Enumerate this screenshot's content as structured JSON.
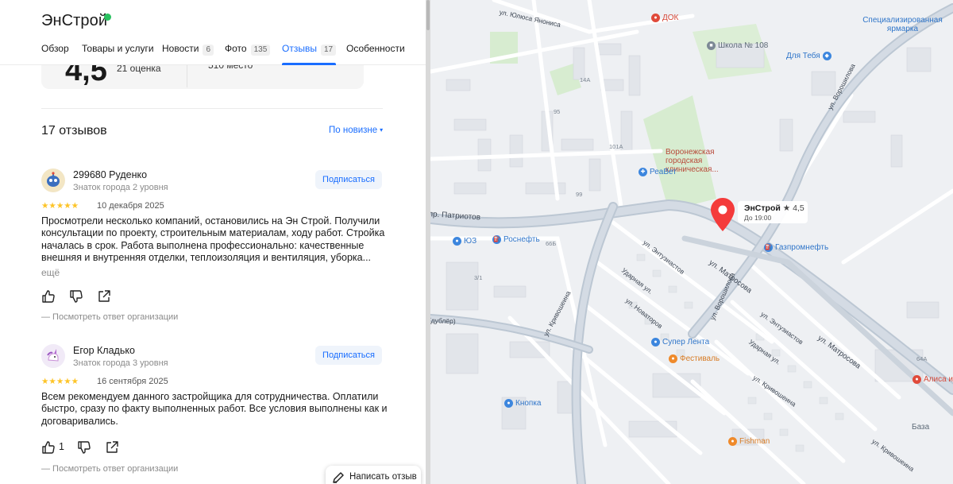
{
  "org": {
    "title": "ЭнСтрой"
  },
  "tabs": [
    {
      "label": "Обзор",
      "count": ""
    },
    {
      "label": "Товары и услуги",
      "count": ""
    },
    {
      "label": "Новости",
      "count": "6"
    },
    {
      "label": "Фото",
      "count": "135"
    },
    {
      "label": "Отзывы",
      "count": "17"
    },
    {
      "label": "Особенности",
      "count": ""
    }
  ],
  "rating": {
    "value": "4,5",
    "count_label": "21 оценка",
    "place_label": "510 место"
  },
  "reviews_section": {
    "heading": "17 отзывов",
    "sort_label": "По новизне",
    "sort_caret": "▾"
  },
  "reviews": [
    {
      "author": "299680 Руденко",
      "level": "Знаток города 2 уровня",
      "subscribe": "Подписаться",
      "stars": "★★★★★",
      "rating": 5,
      "date": "10 декабря 2025",
      "text": "Просмотрели несколько компаний, остановились на Эн Строй. Получили консультации по проекту, строительным материалам, ходу работ. Стройка началась в срок. Работа выполнена профессионально: качественные внешняя и внутренняя отделки, теплоизоляция и вентиляция, уборка...",
      "more": "ещё",
      "likes": "",
      "answer_link": "— Посмотреть ответ организации"
    },
    {
      "author": "Егор Кладько",
      "level": "Знаток города 3 уровня",
      "subscribe": "Подписаться",
      "stars": "★★★★★",
      "rating": 5,
      "date": "16 сентября 2025",
      "text": "Всем рекомендуем данного застройщика для сотрудничества. Оплатили быстро, сразу по факту выполненных работ. Все условия выполнены как и договаривались.",
      "more": "",
      "likes": "1",
      "answer_link": "— Посмотреть ответ организации"
    }
  ],
  "write_review": "Написать отзыв",
  "map": {
    "pin": {
      "name": "ЭнСтрой",
      "rating": "★ 4,5",
      "hours": "До 19:00"
    },
    "streets": [
      "ул. Юлюса Янониса",
      "ул. Ворошилова",
      "пр. Патриотов",
      "ул. Энтузиастов",
      "Ударная ул.",
      "ул. Новаторов",
      "ул. Кривошеина",
      "ул. Матросова",
      "ул. Ворошилова",
      "ул. Энтузиастов",
      "Ударная ул.",
      "ул. Кривошеина",
      "ул. Матросова",
      "ул. Кривошеина",
      "(дублёр)"
    ],
    "pois": [
      "ДОК",
      "Специализированная ярмарка",
      "Школа № 108",
      "Для Тебя",
      "Воронежская городская клиническая...",
      "РеаВет",
      "ЮЗ",
      "Роснефть",
      "Газпромнефть",
      "Супер Лента",
      "Фестиваль",
      "Кнопка",
      "Fishman",
      "Алиса и...",
      "База"
    ]
  }
}
